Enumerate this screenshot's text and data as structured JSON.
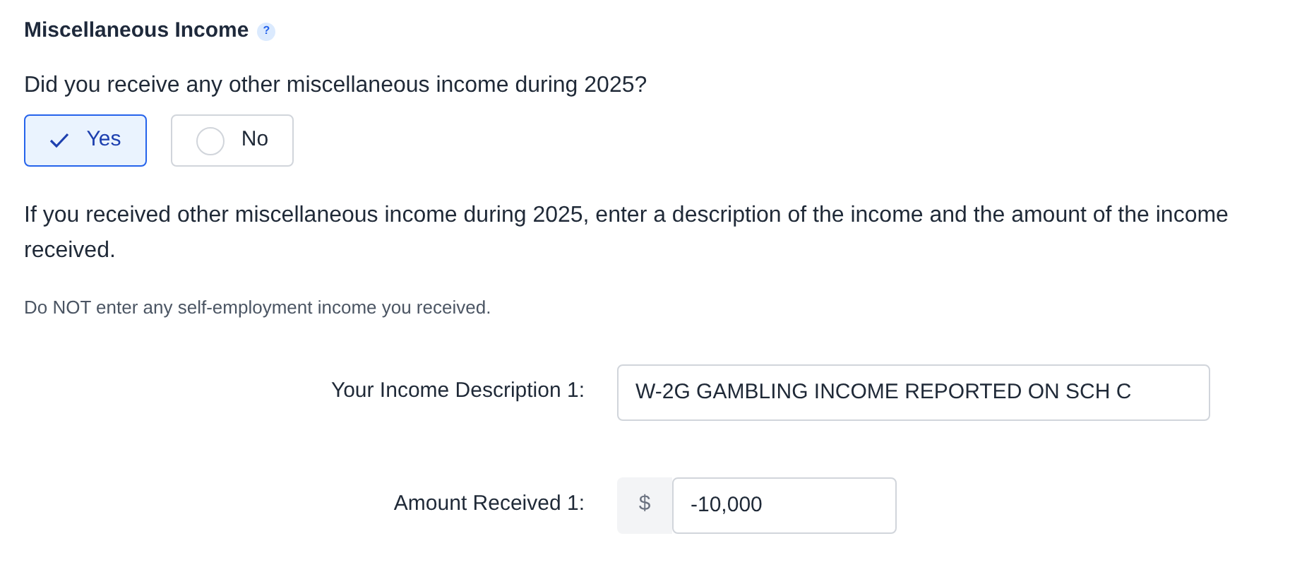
{
  "heading": {
    "title": "Miscellaneous Income",
    "help": "?"
  },
  "question": "Did you receive any other miscellaneous income during 2025?",
  "options": [
    {
      "label": "Yes",
      "selected": true
    },
    {
      "label": "No",
      "selected": false
    }
  ],
  "instructions": "If you received other miscellaneous income during 2025, enter a description of the income and the amount of the income received.",
  "note": "Do NOT enter any self-employment income you received.",
  "fields": [
    {
      "kind": "text",
      "label": "Your Income Description 1:",
      "value": "W-2G GAMBLING INCOME REPORTED ON SCH C"
    },
    {
      "kind": "currency",
      "label": "Amount Received 1:",
      "prefix": "$",
      "value": "-10,000"
    }
  ]
}
